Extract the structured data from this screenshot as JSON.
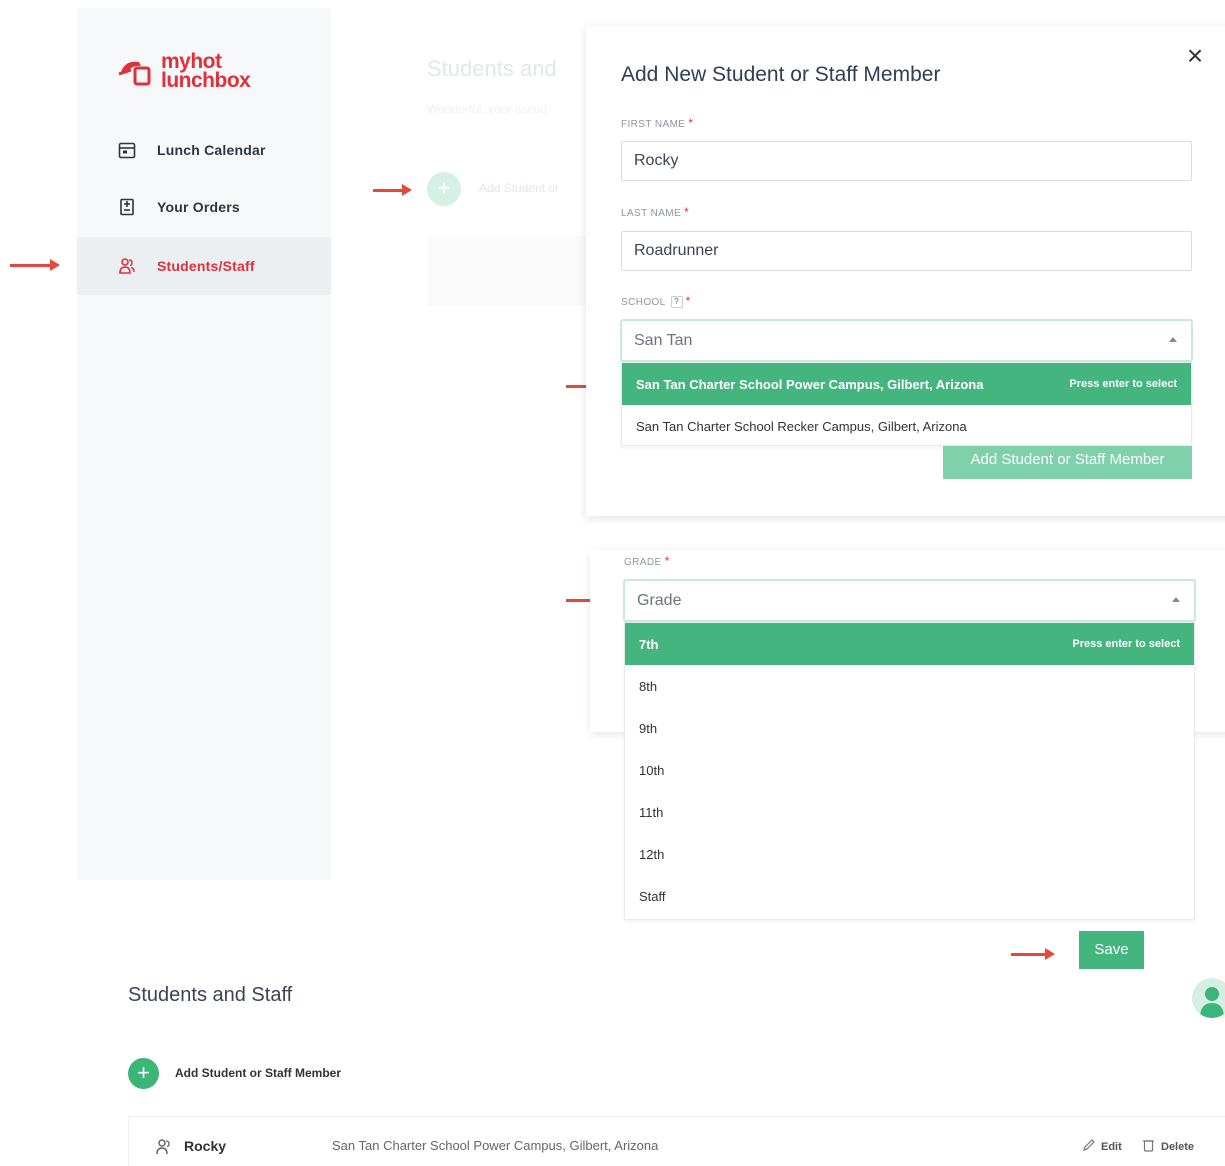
{
  "brand": {
    "logo_line1": "myhot",
    "logo_line2": "lunchbox"
  },
  "sidebar": {
    "items": [
      {
        "label": "Lunch Calendar",
        "icon": "calendar-icon"
      },
      {
        "label": "Your Orders",
        "icon": "orders-icon"
      },
      {
        "label": "Students/Staff",
        "icon": "users-icon",
        "active": true
      }
    ]
  },
  "background_page": {
    "title": "Students and",
    "subtitle": "Wonderful, your accou",
    "add_label": "Add Student or"
  },
  "modal": {
    "title": "Add New Student or Staff Member",
    "first_name": {
      "label": "FIRST NAME",
      "value": "Rocky"
    },
    "last_name": {
      "label": "LAST NAME",
      "value": "Roadrunner"
    },
    "school": {
      "label": "SCHOOL",
      "help": "?",
      "value": "San Tan",
      "options": [
        {
          "label": "San Tan Charter School Power Campus, Gilbert, Arizona",
          "highlighted": true,
          "hint": "Press enter to select"
        },
        {
          "label": "San Tan Charter School Recker Campus, Gilbert, Arizona",
          "highlighted": false
        }
      ]
    },
    "submit_label": "Add Student or Staff Member"
  },
  "grade": {
    "label": "GRADE",
    "placeholder": "Grade",
    "options": [
      {
        "label": "7th",
        "highlighted": true,
        "hint": "Press enter to select"
      },
      {
        "label": "8th"
      },
      {
        "label": "9th"
      },
      {
        "label": "10th"
      },
      {
        "label": "11th"
      },
      {
        "label": "12th"
      },
      {
        "label": "Staff"
      }
    ],
    "save_label": "Save"
  },
  "page": {
    "title": "Students and Staff",
    "add_label": "Add Student or Staff Member",
    "rows": [
      {
        "name": "Rocky",
        "school": "San Tan Charter School Power Campus, Gilbert, Arizona",
        "edit_label": "Edit",
        "delete_label": "Delete"
      }
    ]
  },
  "colors": {
    "brand_red": "#e0303b",
    "accent_green": "#45b580",
    "arrow": "#e34a3b"
  },
  "required_marker": "*"
}
